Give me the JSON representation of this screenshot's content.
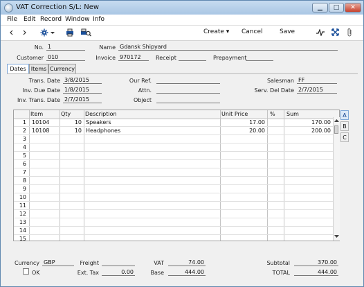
{
  "window": {
    "title": "VAT Correction S/L: New"
  },
  "menu": [
    "File",
    "Edit",
    "Record",
    "Window",
    "Info"
  ],
  "toolbar": {
    "create": "Create",
    "cancel": "Cancel",
    "save": "Save"
  },
  "header": {
    "no_label": "No.",
    "no_value": "1",
    "name_label": "Name",
    "name_value": "Gdansk Shipyard",
    "customer_label": "Customer",
    "customer_value": "010",
    "invoice_label": "Invoice",
    "invoice_value": "970172",
    "receipt_label": "Receipt",
    "receipt_value": "",
    "prepayment_label": "Prepayment",
    "prepayment_value": ""
  },
  "tabs": [
    "Dates",
    "Items",
    "Currency"
  ],
  "dates": {
    "trans_date_label": "Trans. Date",
    "trans_date": "3/8/2015",
    "inv_due_label": "Inv. Due Date",
    "inv_due": "1/8/2015",
    "inv_trans_label": "Inv. Trans. Date",
    "inv_trans": "2/7/2015",
    "our_ref_label": "Our Ref.",
    "our_ref": "",
    "attn_label": "Attn.",
    "attn": "",
    "object_label": "Object",
    "object": "",
    "salesman_label": "Salesman",
    "salesman": "FF",
    "serv_del_label": "Serv. Del Date",
    "serv_del": "2/7/2015"
  },
  "grid": {
    "headers": {
      "item": "Item",
      "qty": "Qty",
      "description": "Description",
      "unit_price": "Unit Price",
      "pct": "%",
      "sum": "Sum"
    },
    "rows": [
      {
        "n": "1",
        "item": "10104",
        "qty": "10",
        "description": "Speakers",
        "unit_price": "17.00",
        "pct": "",
        "sum": "170.00"
      },
      {
        "n": "2",
        "item": "10108",
        "qty": "10",
        "description": "Headphones",
        "unit_price": "20.00",
        "pct": "",
        "sum": "200.00"
      },
      {
        "n": "3"
      },
      {
        "n": "4"
      },
      {
        "n": "5"
      },
      {
        "n": "6"
      },
      {
        "n": "7"
      },
      {
        "n": "8"
      },
      {
        "n": "9"
      },
      {
        "n": "10"
      },
      {
        "n": "11"
      },
      {
        "n": "12"
      },
      {
        "n": "13"
      },
      {
        "n": "14"
      },
      {
        "n": "15"
      }
    ],
    "side_tabs": [
      "A",
      "B",
      "C"
    ]
  },
  "footer": {
    "currency_label": "Currency",
    "currency": "GBP",
    "freight_label": "Freight",
    "freight": "",
    "vat_label": "VAT",
    "vat": "74.00",
    "subtotal_label": "Subtotal",
    "subtotal": "370.00",
    "ok_label": "OK",
    "ext_tax_label": "Ext. Tax",
    "ext_tax": "0.00",
    "base_label": "Base",
    "base": "444.00",
    "total_label": "TOTAL",
    "total": "444.00"
  }
}
